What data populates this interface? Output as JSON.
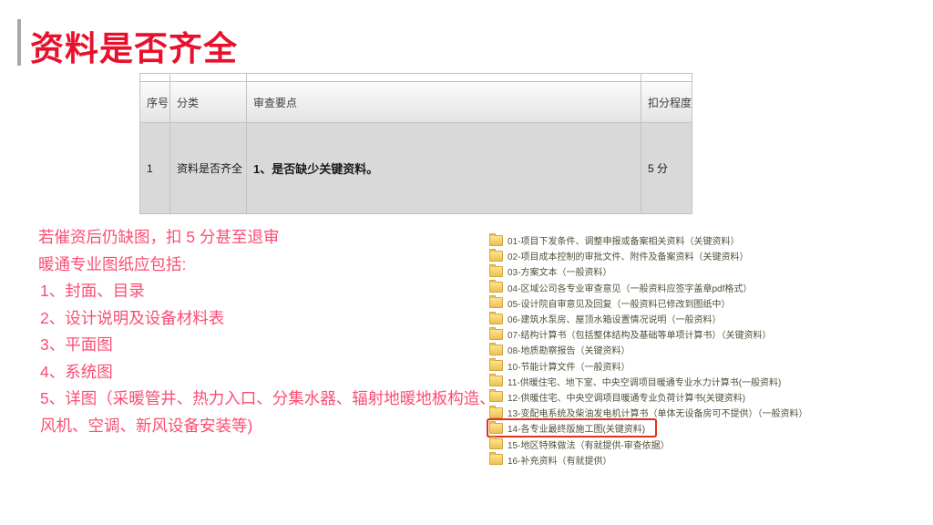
{
  "slide": {
    "title": "资料是否齐全"
  },
  "table": {
    "headers": [
      "序号",
      "分类",
      "审查要点",
      "扣分程度"
    ],
    "row": {
      "no": "1",
      "category": "资料是否齐全",
      "points": "1、是否缺少关键资料。",
      "deduction": "5 分"
    }
  },
  "notes": {
    "line1": "若催资后仍缺图，扣 5 分甚至退审",
    "line2": "暖通专业图纸应包括:",
    "items": [
      {
        "label": "1、封面、目录"
      },
      {
        "label": "2、设计说明及设备材料表"
      },
      {
        "label": "3、平面图"
      },
      {
        "label": "4、系统图"
      },
      {
        "label": "5、详图（采暖管井、热力入口、分集水器、辐射地暖地板构造、风机、空调、新风设备安装等)"
      }
    ]
  },
  "folders": {
    "icon": "folder-icon",
    "items": [
      {
        "label": "01-项目下发条件、调整申报或备案相关资料（关键资料）",
        "highlighted": false
      },
      {
        "label": "02-项目成本控制的审批文件、附件及备案资料（关键资料）",
        "highlighted": false
      },
      {
        "label": "03-方案文本（一般资料）",
        "highlighted": false
      },
      {
        "label": "04-区域公司各专业审查意见（一般资料应签字盖章pdf格式）",
        "highlighted": false
      },
      {
        "label": "05-设计院自审意见及回复（一般资料已修改到图纸中）",
        "highlighted": false
      },
      {
        "label": "06-建筑水泵房、屋顶水箱设置情况说明（一般资料）",
        "highlighted": false
      },
      {
        "label": "07-结构计算书（包括整体结构及基础等单项计算书）（关键资料）",
        "highlighted": false
      },
      {
        "label": "08-地质勘察报告（关键资料）",
        "highlighted": false
      },
      {
        "label": "10-节能计算文件（一般资料）",
        "highlighted": false
      },
      {
        "label": "11-供暖住宅、地下室、中央空调项目暖通专业水力计算书(一般资料)",
        "highlighted": false
      },
      {
        "label": "12-供暖住宅、中央空调项目暖通专业负荷计算书(关键资料)",
        "highlighted": false
      },
      {
        "label": "13-变配电系统及柴油发电机计算书（单体无设备房可不提供）（一般资料）",
        "highlighted": false
      },
      {
        "label": "14-各专业最终版施工图(关键资料)",
        "highlighted": true
      },
      {
        "label": "15-地区特殊做法（有就提供-审查依据）",
        "highlighted": false
      },
      {
        "label": "16-补充资料（有就提供）",
        "highlighted": false
      }
    ]
  },
  "colors": {
    "title-red": "#e8112d",
    "notes-pink": "#fb4d72",
    "folder-text": "#52503a",
    "folder-yellow": "#edc054",
    "highlight-red": "#e0301e",
    "accent-bar-gray": "#a8a8a8"
  }
}
